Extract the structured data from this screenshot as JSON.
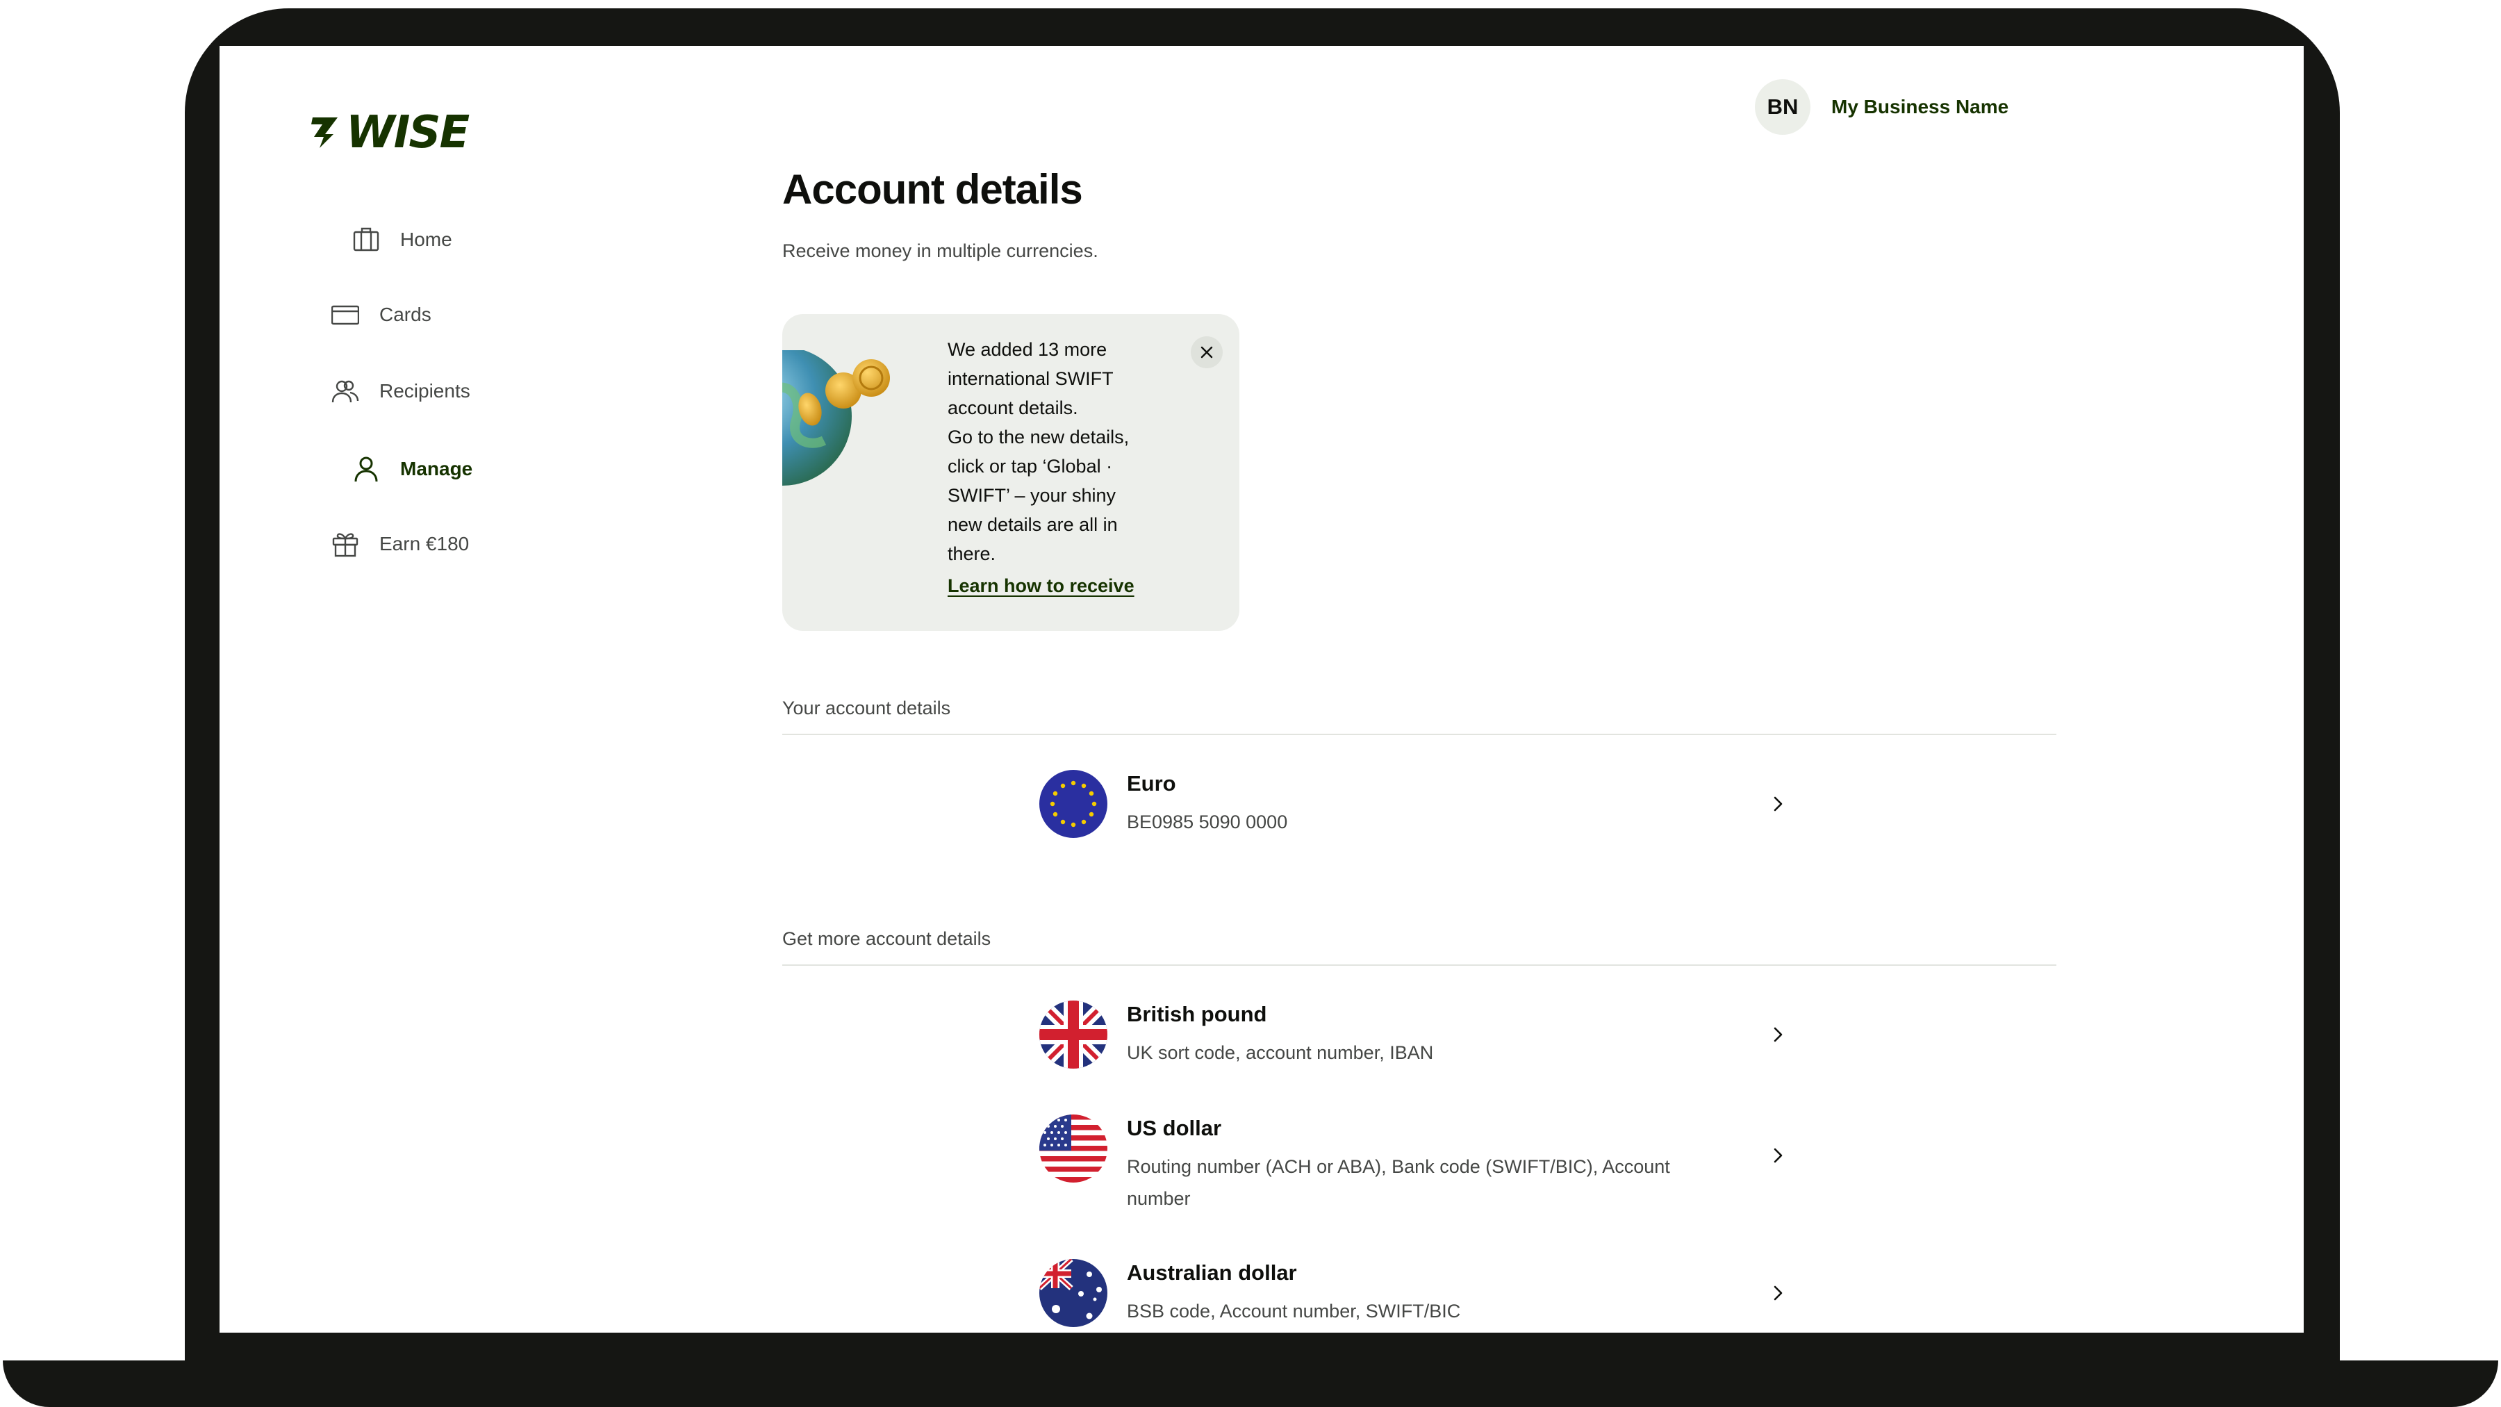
{
  "app": {
    "brand": "WISE"
  },
  "sidebar": {
    "items": [
      {
        "label": "Home",
        "icon": "briefcase-icon",
        "active": false
      },
      {
        "label": "Cards",
        "icon": "card-icon",
        "active": false
      },
      {
        "label": "Recipients",
        "icon": "people-icon",
        "active": false
      },
      {
        "label": "Manage",
        "icon": "person-icon",
        "active": true
      },
      {
        "label": "Earn €180",
        "icon": "gift-icon",
        "active": false
      }
    ]
  },
  "header": {
    "avatar_initials": "BN",
    "business_name": "My Business Name"
  },
  "main": {
    "title": "Account details",
    "subtitle": "Receive money in multiple currencies.",
    "promo": {
      "text_lines": [
        "We added 13 more",
        "international SWIFT",
        "account details.",
        "Go to the new details,",
        "click or tap ‘Global ·",
        "SWIFT’ – your shiny",
        "new details are all in",
        "there."
      ],
      "link": "Learn how to receive"
    },
    "your_accounts": {
      "label": "Your account details",
      "items": [
        {
          "name": "Euro",
          "detail": "BE0985 5090 0000",
          "flag": "eu-flag-icon"
        }
      ]
    },
    "more_accounts": {
      "label": "Get more account details",
      "items": [
        {
          "name": "British pound",
          "detail": "UK sort code, account number, IBAN",
          "flag": "uk-flag-icon"
        },
        {
          "name": "US dollar",
          "detail": "Routing number (ACH or ABA), Bank code (SWIFT/BIC), Account number",
          "flag": "us-flag-icon"
        },
        {
          "name": "Australian dollar",
          "detail": "BSB code, Account number, SWIFT/BIC",
          "flag": "au-flag-icon"
        }
      ]
    }
  },
  "colors": {
    "brand_green": "#163300",
    "promo_bg": "#edefeb",
    "text_secondary": "#454745"
  }
}
